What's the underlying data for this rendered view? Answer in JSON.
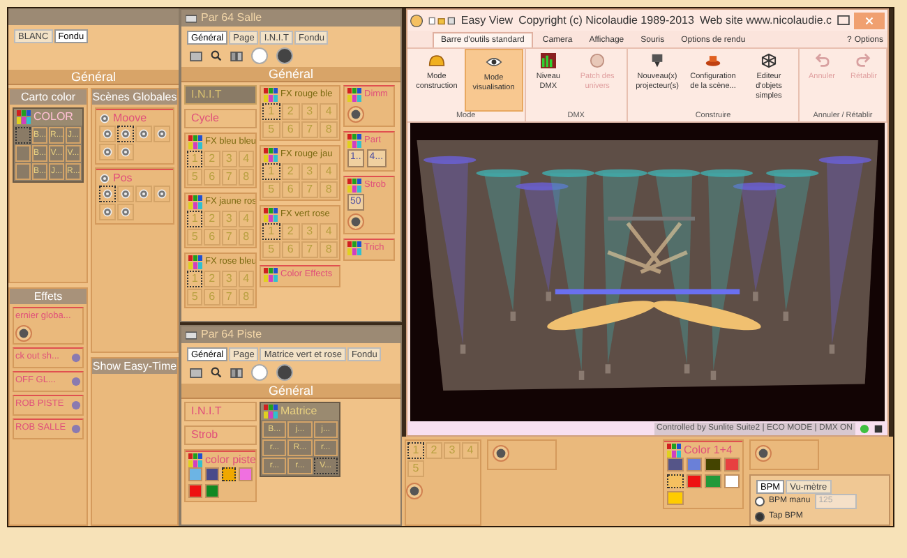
{
  "left_panel": {
    "tabs": [
      {
        "label": "BLANC",
        "selected": false
      },
      {
        "label": "Fondu",
        "selected": true
      }
    ],
    "header": "Général",
    "carto_color": {
      "title": "Carto color",
      "widget": {
        "kind": "matrix",
        "title": "COLOR",
        "cells": [
          {
            "selected": true
          },
          {
            "label": "B...",
            "selected": false
          },
          {
            "label": "R...",
            "selected": false
          },
          {
            "label": "J...",
            "selected": false
          },
          {
            "selected": false
          },
          {
            "label": "B...",
            "selected": false
          },
          {
            "label": "V...",
            "selected": false
          },
          {
            "label": "V...",
            "selected": false
          },
          {
            "selected": false
          },
          {
            "label": "B...",
            "selected": false
          },
          {
            "label": "J...",
            "selected": false
          },
          {
            "label": "R...",
            "selected": false
          }
        ]
      }
    },
    "scenes": {
      "title": "Scènes Globales",
      "widgets": [
        {
          "kind": "scene",
          "title": "Moove",
          "buttons": [
            {
              "selected": false
            },
            {
              "selected": true
            },
            {
              "selected": false
            },
            {
              "selected": false
            },
            {
              "selected": false
            },
            {
              "selected": false
            }
          ]
        },
        {
          "kind": "scene",
          "title": "Pos",
          "buttons": [
            {
              "selected": true
            },
            {
              "selected": false
            },
            {
              "selected": false
            },
            {
              "selected": false
            },
            {
              "selected": false
            },
            {
              "selected": false
            }
          ]
        }
      ]
    },
    "effets": {
      "title": "Effets",
      "widgets": [
        {
          "kind": "toggle",
          "title": "ernier globa...",
          "knob": true
        },
        {
          "kind": "toggle",
          "title": "ck out sh...",
          "knob": false
        },
        {
          "kind": "toggle",
          "title": "OFF GL...",
          "knob": false
        },
        {
          "kind": "toggle",
          "title": "ROB PISTE",
          "knob": false
        },
        {
          "kind": "toggle",
          "title": "ROB SALLE",
          "knob": false
        }
      ]
    },
    "show": {
      "title": "Show Easy-Time"
    }
  },
  "par64_salle": {
    "title": "Par 64 Salle",
    "tabs": [
      {
        "label": "Général",
        "selected": true
      },
      {
        "label": "Page",
        "selected": false
      },
      {
        "label": "I.N.I.T",
        "selected": false
      },
      {
        "label": "Fondu",
        "selected": false
      }
    ],
    "header": "Général",
    "columns": [
      [
        {
          "kind": "button",
          "text": "I.N.I.T",
          "active": true
        },
        {
          "kind": "button",
          "text": "Cycle",
          "active": false
        },
        {
          "kind": "grid",
          "title": "FX bleu bleu",
          "cells": [
            {
              "label": "1",
              "selected": true
            },
            {
              "label": "2",
              "selected": false
            },
            {
              "label": "3",
              "selected": false
            },
            {
              "label": "4",
              "selected": false
            },
            {
              "label": "5",
              "selected": false
            },
            {
              "label": "6",
              "selected": false
            },
            {
              "label": "7",
              "selected": false
            },
            {
              "label": "8",
              "selected": false
            }
          ]
        },
        {
          "kind": "grid",
          "title": "FX jaune ros",
          "cells": [
            {
              "label": "1",
              "selected": true
            },
            {
              "label": "2",
              "selected": false
            },
            {
              "label": "3",
              "selected": false
            },
            {
              "label": "4",
              "selected": false
            },
            {
              "label": "5",
              "selected": false
            },
            {
              "label": "6",
              "selected": false
            },
            {
              "label": "7",
              "selected": false
            },
            {
              "label": "8",
              "selected": false
            }
          ]
        },
        {
          "kind": "grid",
          "title": "FX rose bleu",
          "cells": [
            {
              "label": "1",
              "selected": true
            },
            {
              "label": "2",
              "selected": false
            },
            {
              "label": "3",
              "selected": false
            },
            {
              "label": "4",
              "selected": false
            },
            {
              "label": "5",
              "selected": false
            },
            {
              "label": "6",
              "selected": false
            },
            {
              "label": "7",
              "selected": false
            },
            {
              "label": "8",
              "selected": false
            }
          ]
        }
      ],
      [
        {
          "kind": "grid",
          "title": "FX rouge ble",
          "cells": [
            {
              "label": "1",
              "selected": true
            },
            {
              "label": "2",
              "selected": false
            },
            {
              "label": "3",
              "selected": false
            },
            {
              "label": "4",
              "selected": false
            },
            {
              "label": "5",
              "selected": false
            },
            {
              "label": "6",
              "selected": false
            },
            {
              "label": "7",
              "selected": false
            },
            {
              "label": "8",
              "selected": false
            }
          ]
        },
        {
          "kind": "grid",
          "title": "FX rouge jau",
          "cells": [
            {
              "label": "1",
              "selected": true
            },
            {
              "label": "2",
              "selected": false
            },
            {
              "label": "3",
              "selected": false
            },
            {
              "label": "4",
              "selected": false
            },
            {
              "label": "5",
              "selected": false
            },
            {
              "label": "6",
              "selected": false
            },
            {
              "label": "7",
              "selected": false
            },
            {
              "label": "8",
              "selected": false
            }
          ]
        },
        {
          "kind": "grid",
          "title": "FX vert rose",
          "cells": [
            {
              "label": "1",
              "selected": true
            },
            {
              "label": "2",
              "selected": false
            },
            {
              "label": "3",
              "selected": false
            },
            {
              "label": "4",
              "selected": false
            },
            {
              "label": "5",
              "selected": false
            },
            {
              "label": "6",
              "selected": false
            },
            {
              "label": "7",
              "selected": false
            },
            {
              "label": "8",
              "selected": false
            }
          ]
        },
        {
          "kind": "effect",
          "title": "Color Effects"
        }
      ],
      [
        {
          "kind": "effect",
          "title": "Dimm",
          "knob": true
        },
        {
          "kind": "effect",
          "title": "Part",
          "values": [
            "1..",
            "4..."
          ]
        },
        {
          "kind": "effect",
          "title": "Strob",
          "values": [
            "50"
          ],
          "knob": true
        },
        {
          "kind": "effect",
          "title": "Trich"
        }
      ]
    ]
  },
  "par64_piste": {
    "title": "Par 64 Piste",
    "tabs": [
      {
        "label": "Général",
        "selected": true
      },
      {
        "label": "Page",
        "selected": false
      },
      {
        "label": "Matrice vert et rose",
        "selected": false
      },
      {
        "label": "Fondu",
        "selected": false
      }
    ],
    "header": "Général",
    "columns": [
      [
        {
          "kind": "button",
          "text": "I.N.I.T",
          "active": false
        },
        {
          "kind": "button",
          "text": "Strob",
          "active": false
        },
        {
          "kind": "colors",
          "title": "color piste",
          "swatches": [
            {
              "color": "#6cb4e4",
              "selected": false
            },
            {
              "color": "#4a4a8a",
              "selected": false
            },
            {
              "color": "#f0a800",
              "selected": true
            },
            {
              "color": "#f070e0",
              "selected": false
            },
            {
              "color": "#ee1111",
              "selected": false
            },
            {
              "color": "#118822",
              "selected": false
            }
          ]
        }
      ],
      [
        {
          "kind": "matrix",
          "title": "Matrice",
          "cells": [
            {
              "label": "B...",
              "selected": false
            },
            {
              "label": "j...",
              "selected": false
            },
            {
              "label": "j...",
              "selected": false
            },
            {
              "label": "r...",
              "selected": false
            },
            {
              "label": "R...",
              "selected": false
            },
            {
              "label": "r...",
              "selected": false
            },
            {
              "label": "r...",
              "selected": false
            },
            {
              "label": "r...",
              "selected": false
            },
            {
              "label": "V...",
              "selected": true
            }
          ]
        }
      ]
    ]
  },
  "easy_view": {
    "title": "Easy View",
    "copyright": "Copyright (c) Nicolaudie 1989-2013",
    "website": "Web site www.nicolaudie.c",
    "tabs": [
      {
        "label": "Barre d'outils standard",
        "selected": true
      },
      {
        "label": "Camera",
        "selected": false
      },
      {
        "label": "Affichage",
        "selected": false
      },
      {
        "label": "Souris",
        "selected": false
      },
      {
        "label": "Options de rendu",
        "selected": false
      }
    ],
    "help": "?",
    "options": "Options",
    "groups": [
      {
        "label": "Mode",
        "buttons": [
          {
            "label": "Mode construction",
            "selected": false,
            "disabled": false
          },
          {
            "label": "Mode visualisation",
            "selected": true,
            "disabled": false
          }
        ]
      },
      {
        "label": "DMX",
        "buttons": [
          {
            "label": "Niveau DMX",
            "selected": false,
            "disabled": false
          },
          {
            "label": "Patch des univers",
            "selected": false,
            "disabled": true
          }
        ]
      },
      {
        "label": "Construire",
        "buttons": [
          {
            "label": "Nouveau(x) projecteur(s)",
            "selected": false,
            "disabled": false
          },
          {
            "label": "Configuration de la scène...",
            "selected": false,
            "disabled": false
          },
          {
            "label": "Editeur d'objets simples",
            "selected": false,
            "disabled": false
          }
        ]
      },
      {
        "label": "Annuler / Rétablir",
        "buttons": [
          {
            "label": "Annuler",
            "selected": false,
            "disabled": true
          },
          {
            "label": "Rétablir",
            "selected": false,
            "disabled": true
          }
        ]
      }
    ],
    "status": "Controlled by Sunlite Suite2 | ECO MODE | DMX ON"
  },
  "lower_panels": {
    "grid": {
      "cells": [
        {
          "label": "1",
          "selected": true
        },
        {
          "label": "2",
          "selected": false
        },
        {
          "label": "3",
          "selected": false
        },
        {
          "label": "4",
          "selected": false
        },
        {
          "label": "5",
          "selected": false
        }
      ]
    },
    "colors": {
      "kind": "colors",
      "title": "Color 1+4",
      "swatches": [
        {
          "color": "#555588",
          "selected": false
        },
        {
          "color": "#6a80d8",
          "selected": false
        },
        {
          "color": "#444400",
          "selected": false
        },
        {
          "color": "#e84040",
          "selected": false
        },
        {
          "color": "#f5c060",
          "selected": true
        },
        {
          "color": "#ee1111",
          "selected": false
        },
        {
          "color": "#22993a",
          "selected": false
        },
        {
          "color": "#ffffff",
          "selected": false
        },
        {
          "color": "#ffcc00",
          "selected": false
        }
      ]
    },
    "bpm": {
      "tabs": [
        {
          "label": "BPM",
          "selected": true
        },
        {
          "label": "Vu-mètre",
          "selected": false
        }
      ],
      "options": [
        {
          "label": "BPM manu",
          "selected": false
        },
        {
          "label": "Tap BPM",
          "selected": true
        }
      ],
      "value": "125"
    }
  }
}
